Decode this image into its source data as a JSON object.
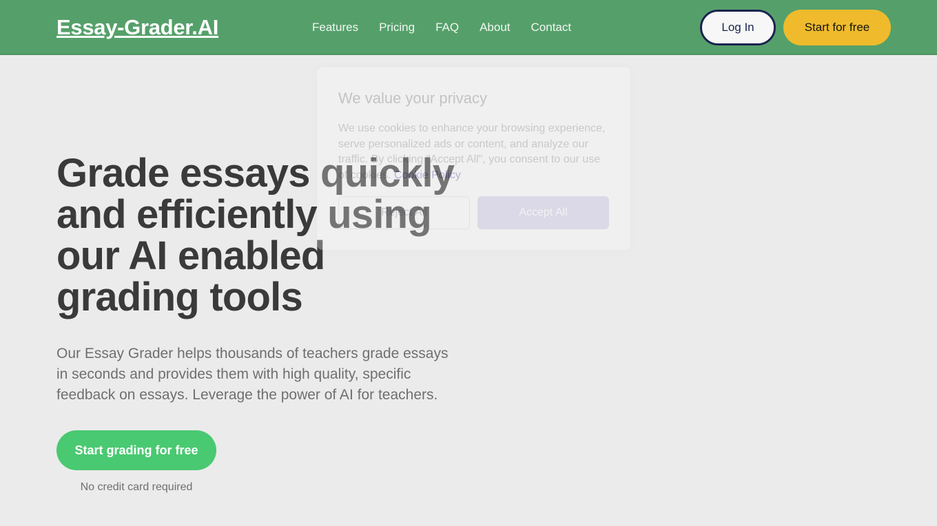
{
  "header": {
    "brand": "Essay-Grader.AI",
    "brand_color": "#ffffff",
    "background_color": "#55a06a",
    "nav": [
      {
        "label": "Features"
      },
      {
        "label": "Pricing"
      },
      {
        "label": "FAQ"
      },
      {
        "label": "About"
      },
      {
        "label": "Contact"
      }
    ],
    "login_label": "Log In",
    "start_free_label": "Start for free",
    "start_free_color": "#efbb2c",
    "login_border_color": "#1b2350"
  },
  "hero": {
    "title": "Grade essays quickly and efficiently using our AI enabled grading tools",
    "subtitle": "Our Essay Grader helps thousands of teachers grade essays in seconds and provides them with high quality, specific feedback on essays. Leverage the power of AI for teachers.",
    "cta_label": "Start grading for free",
    "cta_color": "#49c971",
    "cta_note": "No credit card required"
  },
  "cookie_dialog": {
    "title": "We value your privacy",
    "body_text": "We use cookies to enhance your browsing experience, serve personalized ads or content, and analyze our traffic. By clicking \"Accept All\", you consent to our use of cookies. ",
    "policy_link_label": "Cookie Policy",
    "reject_label": "Reject All",
    "accept_label": "Accept All",
    "accept_color": "#c6c0e2",
    "link_color": "#6c63b5"
  },
  "page": {
    "background_color": "#ebebeb"
  }
}
